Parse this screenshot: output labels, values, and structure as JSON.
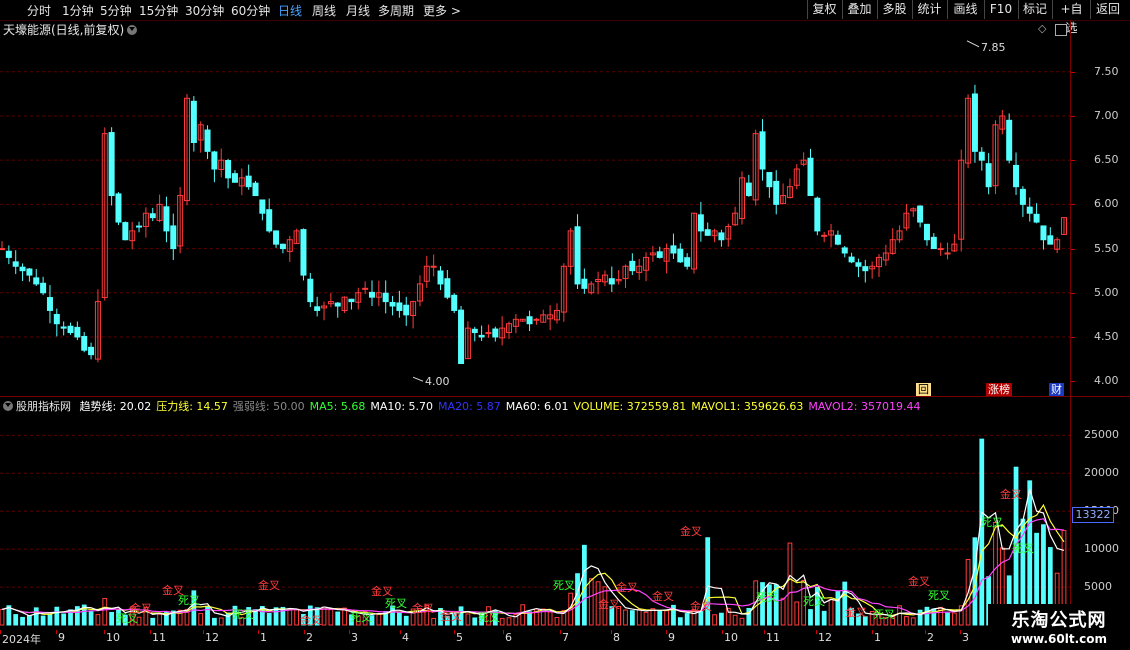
{
  "toolbar": {
    "periods": [
      "分时",
      "1分钟",
      "5分钟",
      "15分钟",
      "30分钟",
      "60分钟",
      "日线",
      "周线",
      "月线",
      "多周期",
      "更多 >"
    ],
    "active_period": "日线",
    "buttons": [
      "复权",
      "叠加",
      "多股",
      "统计",
      "画线",
      "F10",
      "标记",
      "+自选",
      "返回"
    ]
  },
  "title": "天壕能源(日线,前复权)",
  "price_axis": {
    "ticks": [
      "7.50",
      "7.00",
      "6.50",
      "6.00",
      "5.50",
      "5.00",
      "4.50",
      "4.00"
    ],
    "high_label": "7.85",
    "low_label": "4.00"
  },
  "badges": {
    "hui": "回",
    "zhangbang": "涨榜",
    "cai": "财"
  },
  "indicator": {
    "name": "股朋指标网",
    "items": [
      {
        "label": "趋势线: 20.02",
        "color": "#ffffff"
      },
      {
        "label": "压力线: 14.57",
        "color": "#ffff33"
      },
      {
        "label": "强弱线: 50.00",
        "color": "#888888"
      },
      {
        "label": "MA5: 5.68",
        "color": "#33ff33"
      },
      {
        "label": "MA10: 5.70",
        "color": "#ffffff"
      },
      {
        "label": "MA20: 5.87",
        "color": "#3333ff"
      },
      {
        "label": "MA60: 6.01",
        "color": "#ffffff"
      },
      {
        "label": "VOLUME: 372559.81",
        "color": "#ffff33"
      },
      {
        "label": "MAVOL1: 359626.63",
        "color": "#ffff33"
      },
      {
        "label": "MAVOL2: 357019.44",
        "color": "#ff44ff"
      }
    ]
  },
  "volume_axis": {
    "ticks": [
      "25000",
      "20000",
      "15000",
      "10000",
      "5000"
    ],
    "current": "13322"
  },
  "date_axis": [
    "2024年",
    "9",
    "10",
    "11",
    "12",
    "1",
    "2",
    "3",
    "4",
    "5",
    "6",
    "7",
    "8",
    "9",
    "10",
    "11",
    "12",
    "1",
    "2",
    "3"
  ],
  "cross_labels": {
    "golden": "金叉",
    "death": "死叉"
  },
  "watermark": {
    "line1": "乐淘公式网",
    "line2": "www.60lt.com"
  },
  "colors": {
    "up": "#ff3b3b",
    "down": "#54ffff",
    "grid": "#5a0000",
    "yellow": "#ffff33",
    "magenta": "#ff44ff",
    "white": "#ffffff"
  },
  "chart_data": {
    "type": "candlestick",
    "price_range": [
      3.9,
      7.95
    ],
    "series_close": [
      5.5,
      5.4,
      5.3,
      5.25,
      5.2,
      5.1,
      5.0,
      4.8,
      4.65,
      4.6,
      4.55,
      4.5,
      4.35,
      4.3,
      4.9,
      6.8,
      6.1,
      5.8,
      5.6,
      5.7,
      5.75,
      5.9,
      5.85,
      6.0,
      5.7,
      5.5,
      6.1,
      7.2,
      6.7,
      6.9,
      6.6,
      6.4,
      6.5,
      6.3,
      6.25,
      6.3,
      6.2,
      6.1,
      5.9,
      5.7,
      5.55,
      5.5,
      5.6,
      5.7,
      5.2,
      4.9,
      4.8,
      4.85,
      4.9,
      4.85,
      4.95,
      4.9,
      5.0,
      5.05,
      4.95,
      5.0,
      4.9,
      4.85,
      4.8,
      4.75,
      4.9,
      5.1,
      5.3,
      5.3,
      5.1,
      4.95,
      4.8,
      4.2,
      4.6,
      4.55,
      4.5,
      4.55,
      4.5,
      4.6,
      4.65,
      4.7,
      4.7,
      4.65,
      4.7,
      4.75,
      4.75,
      4.8,
      5.3,
      5.7,
      5.1,
      5.05,
      5.1,
      5.15,
      5.2,
      5.1,
      5.15,
      5.3,
      5.25,
      5.3,
      5.4,
      5.45,
      5.4,
      5.5,
      5.45,
      5.35,
      5.3,
      5.9,
      5.7,
      5.65,
      5.7,
      5.6,
      5.75,
      5.9,
      6.3,
      6.1,
      6.8,
      6.4,
      6.2,
      6.0,
      6.1,
      6.2,
      6.4,
      6.5,
      6.1,
      5.7,
      5.65,
      5.7,
      5.55,
      5.45,
      5.35,
      5.3,
      5.25,
      5.3,
      5.4,
      5.45,
      5.6,
      5.7,
      5.9,
      5.95,
      5.8,
      5.6,
      5.5,
      5.5,
      5.45,
      5.55,
      6.5,
      7.2,
      6.6,
      6.5,
      6.2,
      6.9,
      7.0,
      6.5,
      6.2,
      6.0,
      5.9,
      5.8,
      5.6,
      5.55,
      5.6,
      5.85
    ]
  }
}
